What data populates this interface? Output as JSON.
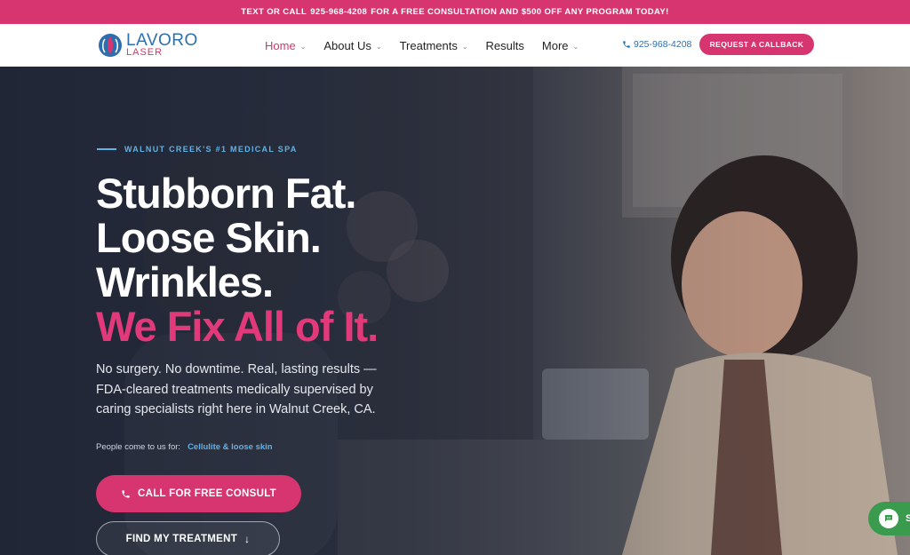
{
  "topbar": {
    "prefix": "TEXT OR CALL",
    "phone": "925-968-4208",
    "suffix": "FOR A FREE CONSULTATION AND $500 OFF ANY PROGRAM TODAY!"
  },
  "header": {
    "logo": {
      "name": "LAVORO",
      "sub": "LASER"
    },
    "nav": [
      {
        "label": "Home",
        "dropdown": true,
        "active": true
      },
      {
        "label": "About Us",
        "dropdown": true
      },
      {
        "label": "Treatments",
        "dropdown": true
      },
      {
        "label": "Results",
        "dropdown": false
      },
      {
        "label": "More",
        "dropdown": true
      }
    ],
    "phone": "925-968-4208",
    "callback_label": "REQUEST A CALLBACK"
  },
  "hero": {
    "eyebrow": "WALNUT CREEK'S #1 MEDICAL SPA",
    "headline": [
      "Stubborn Fat.",
      "Loose Skin.",
      "Wrinkles."
    ],
    "headline_accent": "We Fix All of It.",
    "lead": "No surgery. No downtime. Real, lasting results — FDA-cleared treatments medically supervised by caring specialists right here in Walnut Creek, CA.",
    "come_for_label": "People come to us for:",
    "come_for_value": "Cellulite & loose skin",
    "cta_primary": "CALL FOR FREE CONSULT",
    "cta_secondary": "FIND MY TREATMENT"
  },
  "chat": {
    "label": "S"
  },
  "colors": {
    "brand_pink": "#d6356f",
    "brand_blue": "#2d6fae",
    "accent_blue": "#5fb3e6",
    "chat_green": "#3a9a4d"
  }
}
